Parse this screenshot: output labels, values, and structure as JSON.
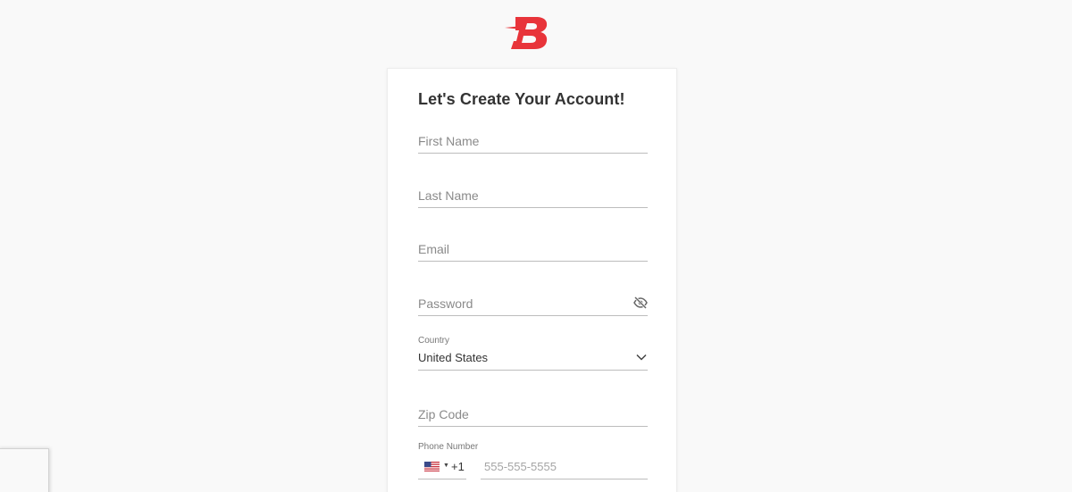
{
  "brand": {
    "logo_letter": "B",
    "logo_color": "#e8343a"
  },
  "form": {
    "title": "Let's Create Your Account!",
    "first_name": {
      "placeholder": "First Name",
      "value": ""
    },
    "last_name": {
      "placeholder": "Last Name",
      "value": ""
    },
    "email": {
      "placeholder": "Email",
      "value": ""
    },
    "password": {
      "placeholder": "Password",
      "value": "",
      "toggle_icon": "eye-slash-icon"
    },
    "country": {
      "label": "Country",
      "value": "United States",
      "icon": "chevron-down-icon"
    },
    "zip": {
      "placeholder": "Zip Code",
      "value": ""
    },
    "phone": {
      "label": "Phone Number",
      "country_flag": "us-flag-icon",
      "country_code": "+1",
      "placeholder": "555-555-5555",
      "value": ""
    }
  },
  "colors": {
    "background": "#f9f9f9",
    "card": "#ffffff",
    "underline": "#bdbdbd",
    "title_text": "#333333",
    "placeholder_text": "#8a8a8a"
  }
}
